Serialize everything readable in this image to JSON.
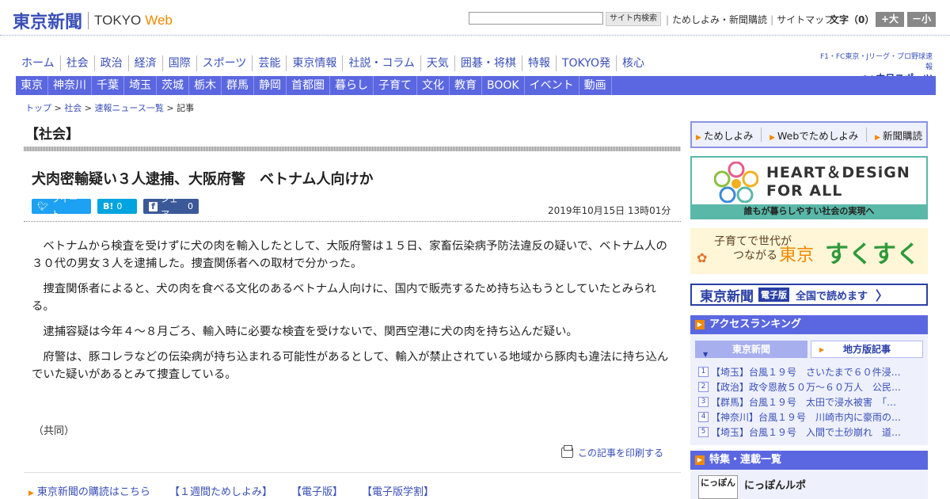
{
  "header": {
    "logo_jp": "東京新聞",
    "logo_en": "TOKYO",
    "logo_web": "Web",
    "search_button": "サイト内検索",
    "links": [
      "ためしよみ・新聞購読",
      "サイトマップ"
    ],
    "font_size_label": "文字（0）",
    "font_larger": "+大",
    "font_smaller": "－小"
  },
  "nav_main": [
    "ホーム",
    "社会",
    "政治",
    "経済",
    "国際",
    "スポーツ",
    "芸能",
    "東京情報",
    "社説・コラム",
    "天気",
    "囲碁・将棋",
    "特報",
    "TOKYO発",
    "核心"
  ],
  "nav_regions": [
    "東京",
    "神奈川",
    "千葉",
    "埼玉",
    "茨城",
    "栃木",
    "群馬",
    "静岡",
    "首都圏",
    "暮らし",
    "子育て",
    "文化",
    "教育",
    "BOOK",
    "イベント",
    "動画"
  ],
  "chunichi": {
    "tagline": "F1・FC東京・Jリーグ・プロ野球速報",
    "prefix": "東京",
    "name": "中日スポーツ"
  },
  "breadcrumb": [
    "トップ",
    "社会",
    "速報ニュース一覧",
    "記事"
  ],
  "breadcrumb_sep": ">",
  "section_title": "【社会】",
  "article": {
    "headline": "犬肉密輸疑い３人逮捕、大阪府警　ベトナム人向けか",
    "share_tweet": "ツイート",
    "share_hatena": "B!",
    "share_hatena_count": "0",
    "share_fb": "シェア",
    "share_fb_count": "0",
    "date": "2019年10月15日 13時01分",
    "paragraphs": [
      "ベトナムから検査を受けずに犬の肉を輸入したとして、大阪府警は１５日、家畜伝染病予防法違反の疑いで、ベトナム人の３０代の男女３人を逮捕した。捜査関係者への取材で分かった。",
      "捜査関係者によると、犬の肉を食べる文化のあるベトナム人向けに、国内で販売するため持ち込もうとしていたとみられる。",
      "逮捕容疑は今年４～８月ごろ、輸入時に必要な検査を受けないで、関西空港に犬の肉を持ち込んだ疑い。",
      "府警は、豚コレラなどの伝染病が持ち込まれる可能性があるとして、輸入が禁止されている地域から豚肉も違法に持ち込んでいた疑いがあるとみて捜査している。"
    ],
    "credit": "（共同）",
    "print_label": "この記事を印刷する"
  },
  "bottom_links": [
    "東京新聞の購読はこちら",
    "【１週間ためしよみ】",
    "【電子版】",
    "【電子版学割】"
  ],
  "sidebar": {
    "trial": [
      "ためしよみ",
      "Webでためしよみ",
      "新聞購読"
    ],
    "heart_title_1": "HEART＆DESiGN",
    "heart_title_2": "FOR ALL",
    "heart_foot": "誰もが暮らしやすい社会の実現へ",
    "suku_small_1": "子育てで世代が",
    "suku_small_2": "つながる",
    "suku_tokyo": "東京",
    "suku_big": "すくすく",
    "denshi_logo": "東京新聞",
    "denshi_tag": "電子版",
    "denshi_text": "全国で読めます",
    "ranking_title": "アクセスランキング",
    "ranking_tab_active": "東京新聞",
    "ranking_tab_other": "地方版記事",
    "ranking": [
      {
        "num": "1",
        "text": "【埼玉】台風１９号　さいたまで６０件浸…"
      },
      {
        "num": "2",
        "text": "【政治】政令恩赦５０万～６０万人　公民…"
      },
      {
        "num": "3",
        "text": "【群馬】台風１９号　太田で浸水被害　「…"
      },
      {
        "num": "4",
        "text": "【神奈川】台風１９号　川崎市内に豪雨の…"
      },
      {
        "num": "5",
        "text": "【埼玉】台風１９号　入間で土砂崩れ　道…"
      }
    ],
    "feature_title": "特集・連載一覧",
    "feature_thumb": "にっぽん",
    "feature_item": "にっぽんルポ"
  },
  "colors": {
    "brand_blue": "#3a4fb8",
    "nav_blue": "#5b67e0",
    "accent_orange": "#f08a00",
    "teal": "#5ab8a8"
  }
}
